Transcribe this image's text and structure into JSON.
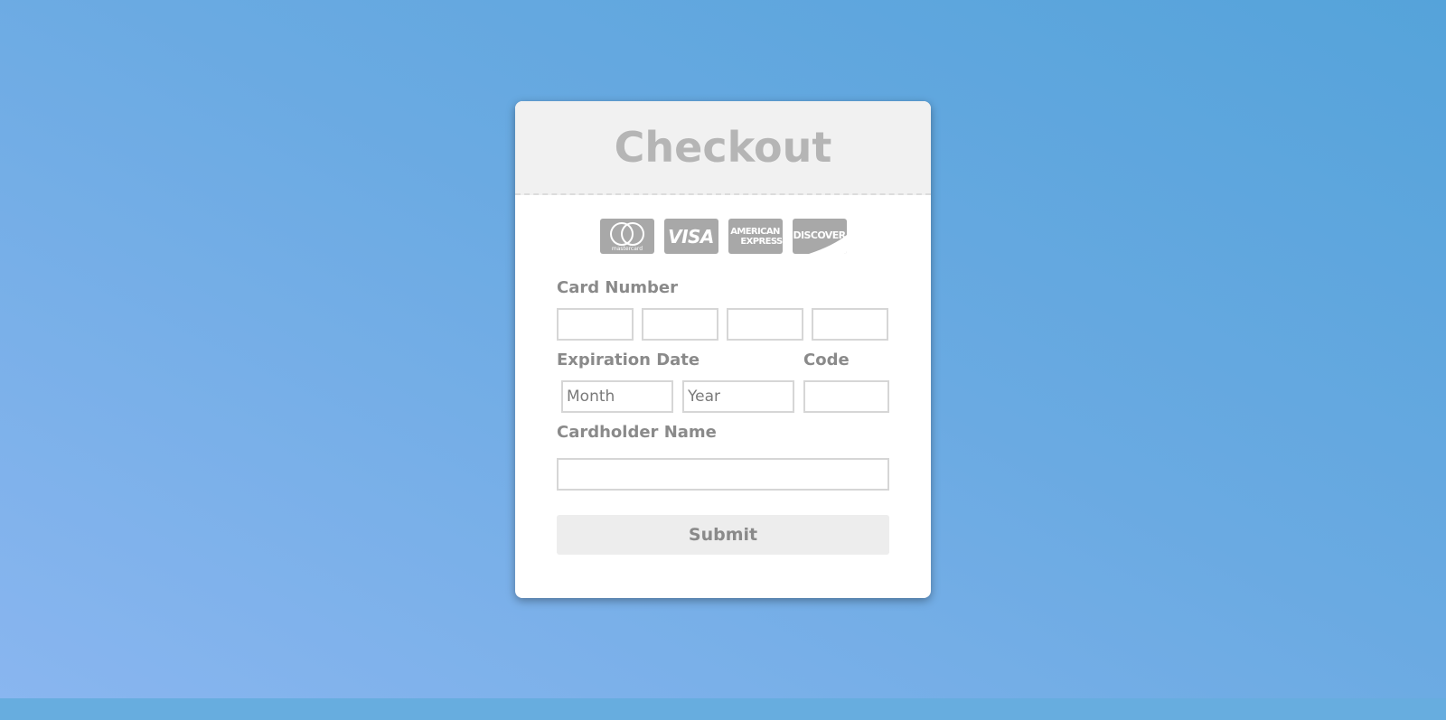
{
  "checkout": {
    "title": "Checkout",
    "card_logos": [
      {
        "name": "Mastercard",
        "text": "mastercard",
        "icon": "mastercard-logo-icon"
      },
      {
        "name": "Visa",
        "text": "VISA",
        "icon": "visa-logo-icon"
      },
      {
        "name": "American Express",
        "text_line1": "AMERICAN",
        "text_line2": "EXPRESS",
        "icon": "amex-logo-icon"
      },
      {
        "name": "Discover",
        "text": "DISCOVER",
        "icon": "discover-logo-icon"
      }
    ],
    "card_number": {
      "label": "Card Number",
      "fields": [
        "",
        "",
        "",
        ""
      ]
    },
    "expiration": {
      "label": "Expiration Date",
      "month_value": "Month",
      "year_value": "Year"
    },
    "code": {
      "label": "Code",
      "value": ""
    },
    "cardholder": {
      "label": "Cardholder Name",
      "value": ""
    },
    "submit_label": "Submit"
  },
  "colors": {
    "background_start": "#8ab6f0",
    "background_end": "#55a3da",
    "card_bg": "#ffffff",
    "header_bg": "#f1f1f1",
    "title_color": "#b5b5b5",
    "label_color": "#8a8a8a",
    "logo_gray": "#a8a8a8",
    "input_border": "#d6d6d6",
    "button_bg": "#ededed"
  }
}
